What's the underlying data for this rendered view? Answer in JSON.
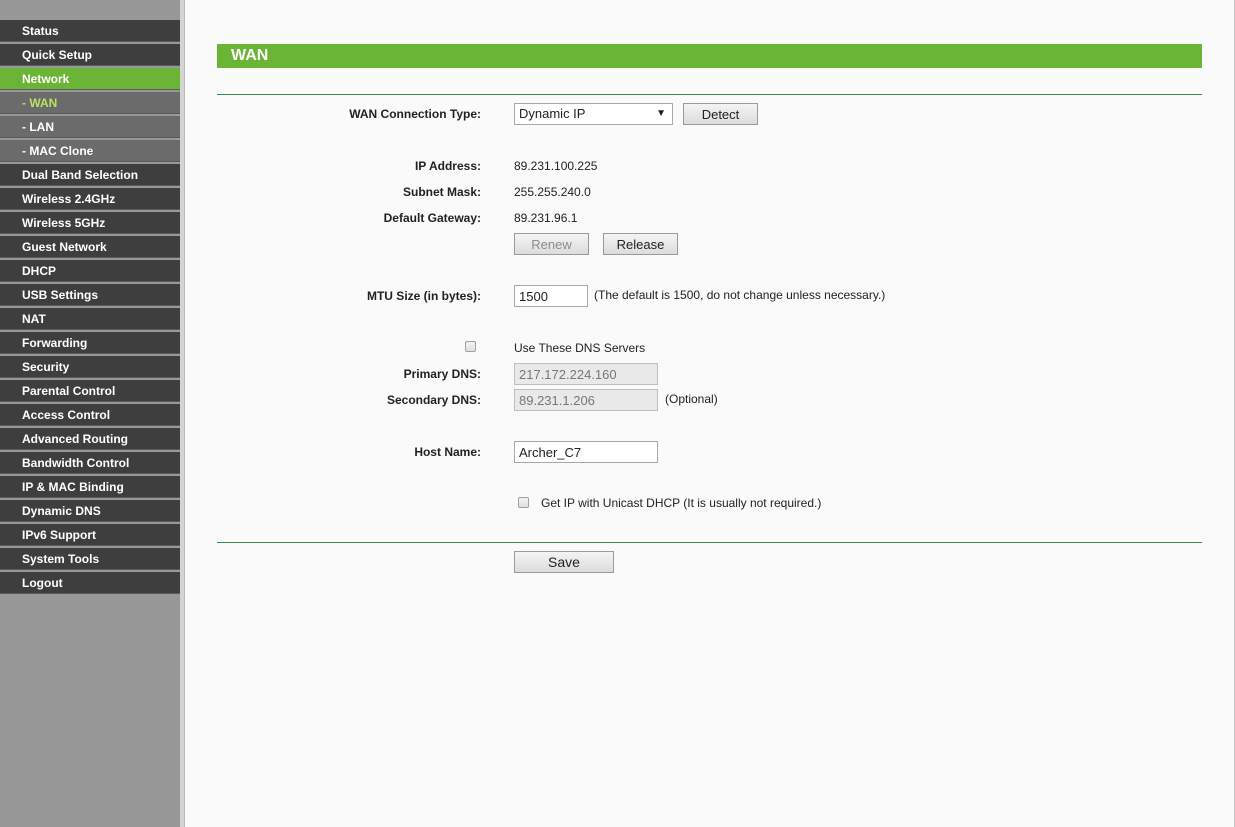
{
  "menu": [
    {
      "label": "Status",
      "type": "main",
      "name": "status"
    },
    {
      "label": "Quick Setup",
      "type": "main",
      "name": "quick-setup"
    },
    {
      "label": "Network",
      "type": "active",
      "name": "network"
    },
    {
      "label": "- WAN",
      "type": "sub-current",
      "name": "wan"
    },
    {
      "label": "- LAN",
      "type": "sub",
      "name": "lan"
    },
    {
      "label": "- MAC Clone",
      "type": "sub",
      "name": "mac-clone"
    },
    {
      "label": "Dual Band Selection",
      "type": "main",
      "name": "dual-band-selection"
    },
    {
      "label": "Wireless 2.4GHz",
      "type": "main",
      "name": "wireless-2-4ghz"
    },
    {
      "label": "Wireless 5GHz",
      "type": "main",
      "name": "wireless-5ghz"
    },
    {
      "label": "Guest Network",
      "type": "main",
      "name": "guest-network"
    },
    {
      "label": "DHCP",
      "type": "main",
      "name": "dhcp"
    },
    {
      "label": "USB Settings",
      "type": "main",
      "name": "usb-settings"
    },
    {
      "label": "NAT",
      "type": "main",
      "name": "nat"
    },
    {
      "label": "Forwarding",
      "type": "main",
      "name": "forwarding"
    },
    {
      "label": "Security",
      "type": "main",
      "name": "security"
    },
    {
      "label": "Parental Control",
      "type": "main",
      "name": "parental-control"
    },
    {
      "label": "Access Control",
      "type": "main",
      "name": "access-control"
    },
    {
      "label": "Advanced Routing",
      "type": "main",
      "name": "advanced-routing"
    },
    {
      "label": "Bandwidth Control",
      "type": "main",
      "name": "bandwidth-control"
    },
    {
      "label": "IP & MAC Binding",
      "type": "main",
      "name": "ip-mac-binding"
    },
    {
      "label": "Dynamic DNS",
      "type": "main",
      "name": "dynamic-dns"
    },
    {
      "label": "IPv6 Support",
      "type": "main",
      "name": "ipv6-support"
    },
    {
      "label": "System Tools",
      "type": "main",
      "name": "system-tools"
    },
    {
      "label": "Logout",
      "type": "main",
      "name": "logout"
    }
  ],
  "page": {
    "title": "WAN",
    "wan_type_label": "WAN Connection Type:",
    "wan_type_value": "Dynamic IP",
    "detect_label": "Detect",
    "ip_label": "IP Address:",
    "ip_value": "89.231.100.225",
    "mask_label": "Subnet Mask:",
    "mask_value": "255.255.240.0",
    "gateway_label": "Default Gateway:",
    "gateway_value": "89.231.96.1",
    "renew_label": "Renew",
    "release_label": "Release",
    "mtu_label": "MTU Size (in bytes):",
    "mtu_value": "1500",
    "mtu_note": "(The default is 1500, do not change unless necessary.)",
    "use_dns_label": "Use These DNS Servers",
    "primary_dns_label": "Primary DNS:",
    "primary_dns_value": "217.172.224.160",
    "secondary_dns_label": "Secondary DNS:",
    "secondary_dns_value": "89.231.1.206",
    "optional_note": "(Optional)",
    "host_label": "Host Name:",
    "host_value": "Archer_C7",
    "unicast_label": "Get IP with Unicast DHCP (It is usually not required.)",
    "save_label": "Save"
  },
  "colors": {
    "accent_green": "#6ab535",
    "menu_dark": "#3e3e3e",
    "menu_sub": "#6b6b6b",
    "sidebar_bg": "#989898",
    "divider_green": "#3c8a4d"
  }
}
